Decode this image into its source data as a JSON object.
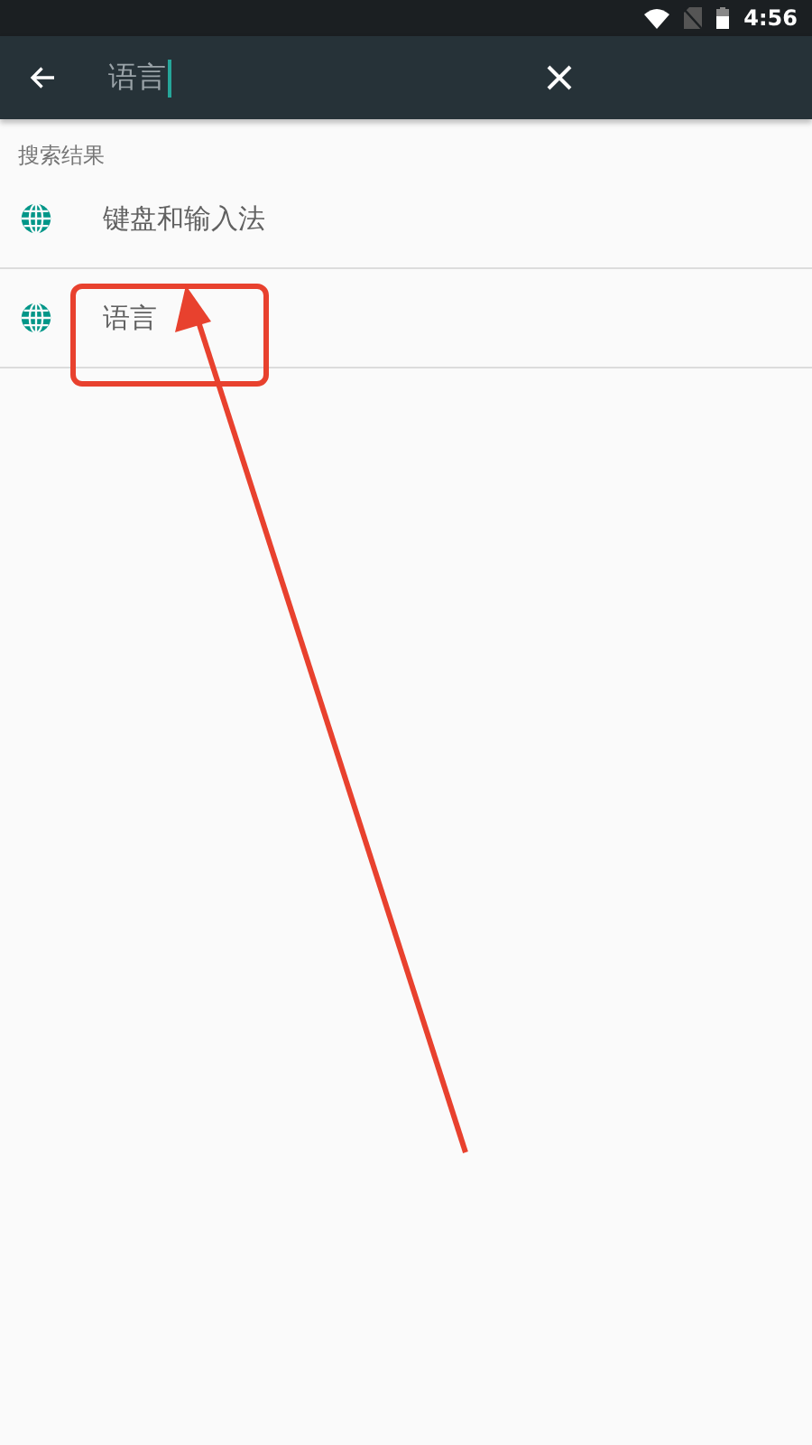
{
  "status_bar": {
    "time": "4:56"
  },
  "search": {
    "value": "语言"
  },
  "section_title": "搜索结果",
  "results": [
    {
      "label": "键盘和输入法",
      "highlighted": false
    },
    {
      "label": "语言",
      "highlighted": true
    }
  ]
}
